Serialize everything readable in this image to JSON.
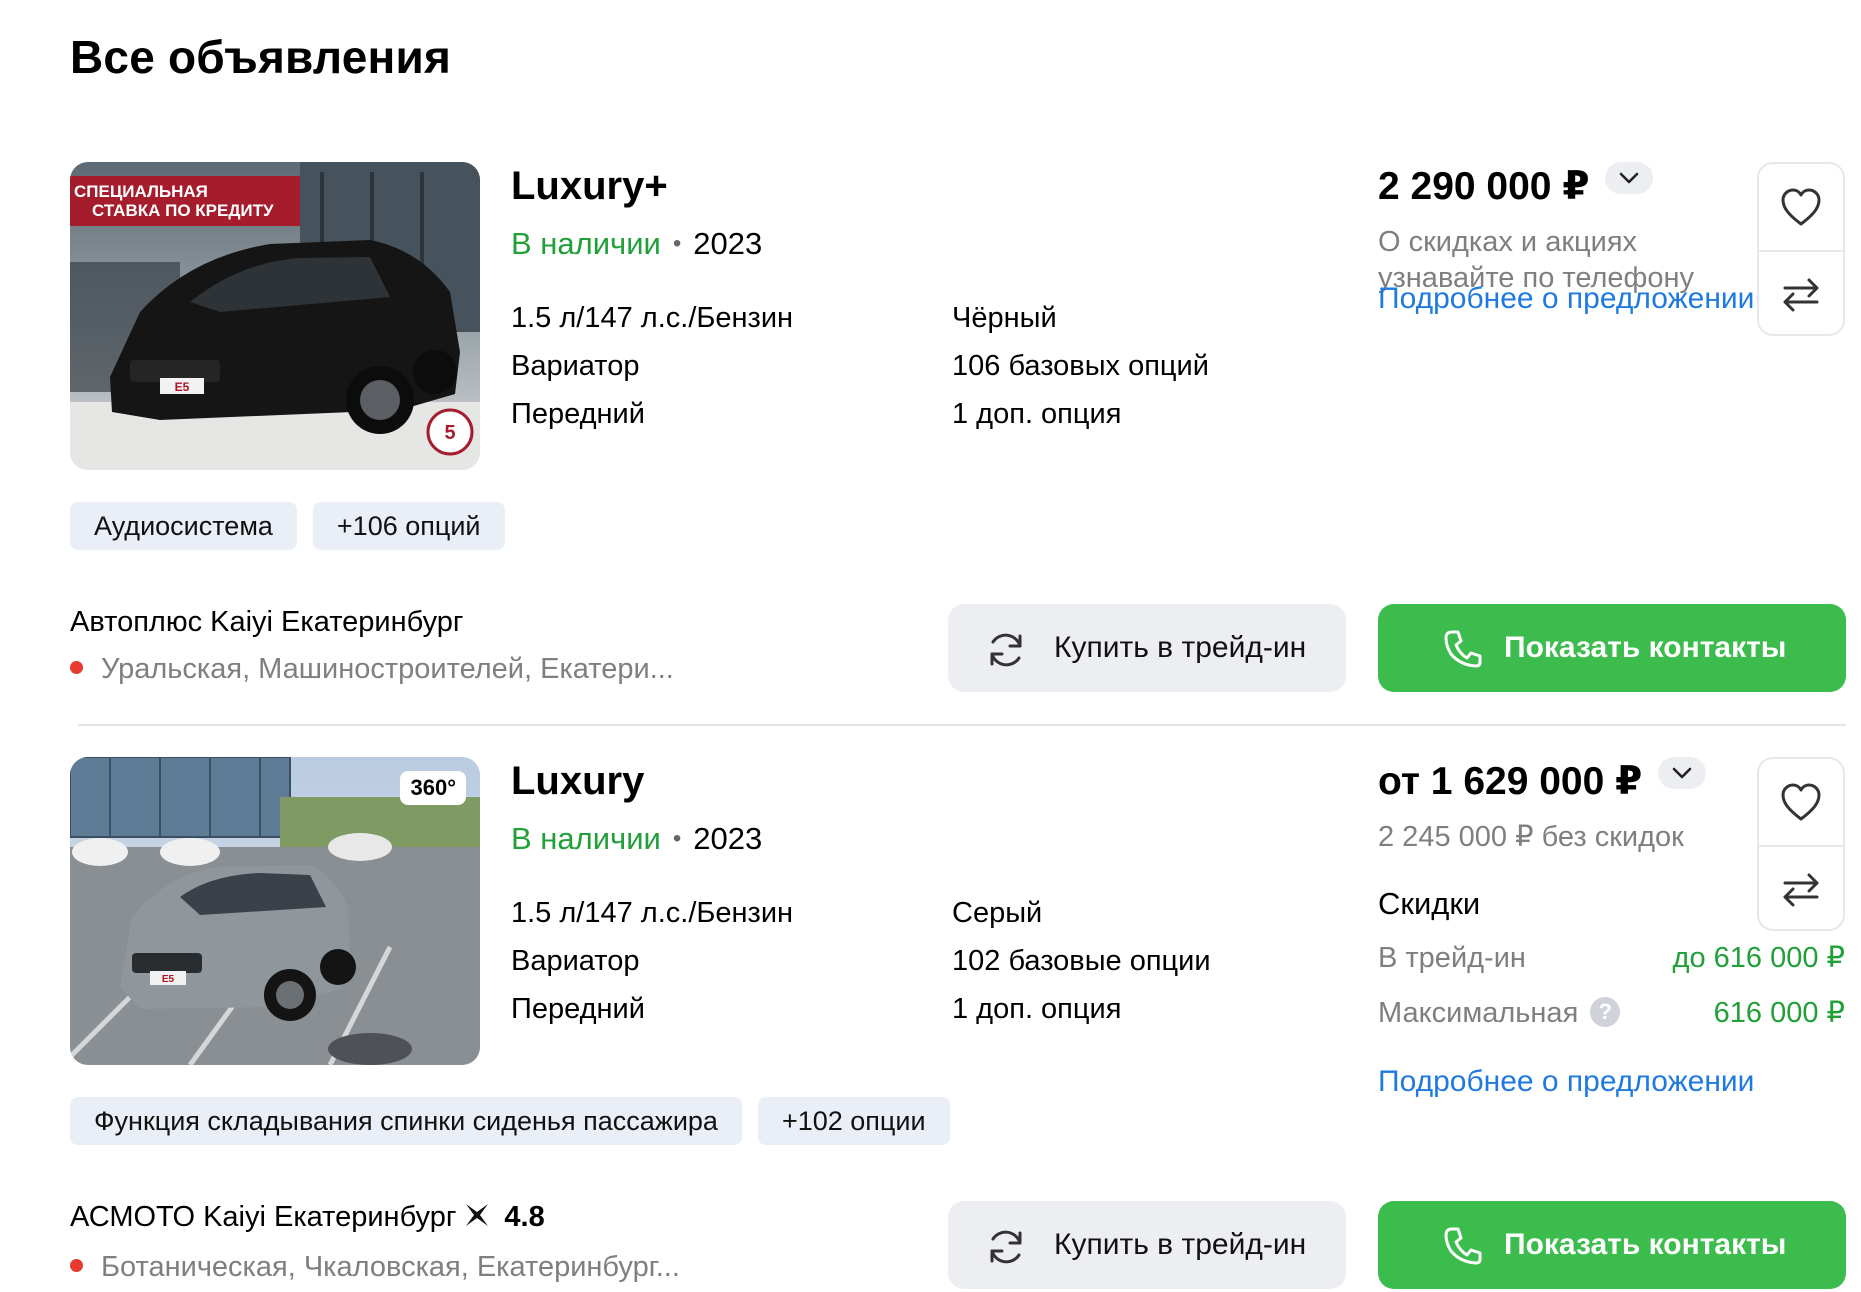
{
  "page": {
    "title": "Все объявления"
  },
  "listings": [
    {
      "title": "Luxury+",
      "availability": "В наличии",
      "separator": "•",
      "year": "2023",
      "specs_left": [
        "1.5 л/147 л.с./Бензин",
        "Вариатор",
        "Передний"
      ],
      "specs_right": [
        "Чёрный",
        "106 базовых опций",
        "1 доп. опция"
      ],
      "photo": {
        "promo_line1": "СПЕЦИАЛЬНАЯ",
        "promo_line2": "СТАВКА ПО КРЕДИТУ",
        "warranty_badge": "5",
        "car_color": "#151515",
        "plate": "E5"
      },
      "price": "2 290 000 ₽",
      "price_note": "О скидках и акциях узнавайте по телефону",
      "details_link": "Подробнее о предложении",
      "tags": [
        "Аудиосистема",
        "+106 опций"
      ],
      "dealer": {
        "name": "Автоплюс Kaiyi Екатеринбург",
        "address": "Уральская, Машиностроителей, Екатери..."
      },
      "trade_in_button": "Купить в трейд-ин",
      "contacts_button": "Показать контакты",
      "favorite_icon": "heart-icon",
      "compare_icon": "compare-arrows-icon"
    },
    {
      "title": "Luxury",
      "availability": "В наличии",
      "separator": "•",
      "year": "2023",
      "specs_left": [
        "1.5 л/147 л.с./Бензин",
        "Вариатор",
        "Передний"
      ],
      "specs_right": [
        "Серый",
        "102 базовые опции",
        "1 доп. опция"
      ],
      "photo": {
        "badge": "360°",
        "car_color": "#8f969c",
        "plate": "E5"
      },
      "price": "от 1 629 000 ₽",
      "price_note": "2 245 000 ₽ без скидок",
      "discounts": {
        "title": "Скидки",
        "rows": [
          {
            "label": "В трейд-ин",
            "value": "до 616 000 ₽"
          },
          {
            "label": "Максимальная",
            "value": "616 000 ₽",
            "help": "?"
          }
        ]
      },
      "details_link": "Подробнее о предложении",
      "tags": [
        "Функция складывания спинки сиденья пассажира",
        "+102 опции"
      ],
      "dealer": {
        "name": "АСМОТО Kaiyi Екатеринбург",
        "rating": "4.8",
        "address": "Ботаническая, Чкаловская, Екатеринбург..."
      },
      "trade_in_button": "Купить в трейд-ин",
      "contacts_button": "Показать контакты",
      "favorite_icon": "heart-icon",
      "compare_icon": "compare-arrows-icon"
    }
  ],
  "colors": {
    "green": "#21a038",
    "button_green": "#3bbc4c",
    "link_blue": "#1f7ae0",
    "muted": "#7f7f7f",
    "tag_bg": "#e9eef7"
  }
}
